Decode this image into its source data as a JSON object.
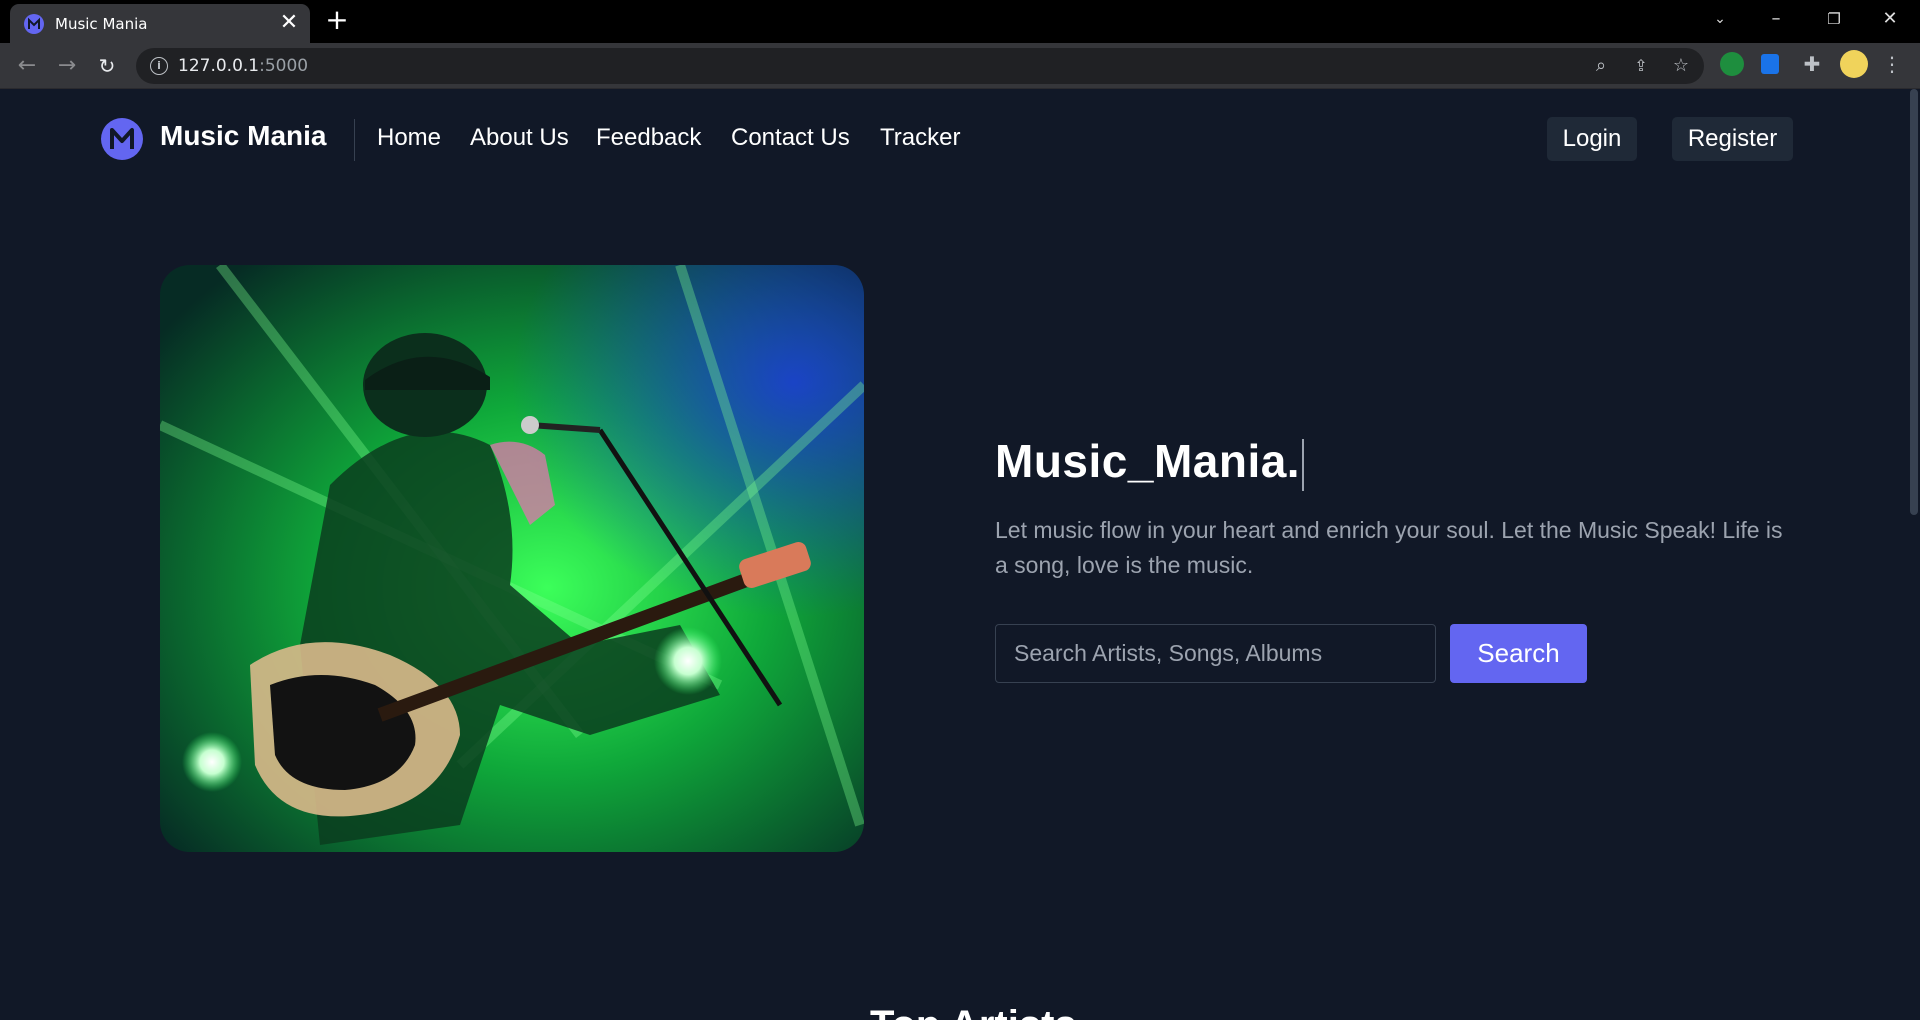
{
  "browser": {
    "tab_title": "Music Mania",
    "tab_close": "✕",
    "new_tab": "+",
    "url_host": "127.0.0.1",
    "url_port": ":5000"
  },
  "nav": {
    "brand": "Music Mania",
    "links": [
      "Home",
      "About Us",
      "Feedback",
      "Contact Us",
      "Tracker"
    ],
    "login": "Login",
    "register": "Register"
  },
  "hero": {
    "title": "Music_Mania.",
    "description": "Let music flow in your heart and enrich your soul. Let the Music Speak! Life is a song, love is the music.",
    "search_placeholder": "Search Artists, Songs, Albums",
    "search_button": "Search"
  },
  "next_section": {
    "heading": "Top Artists"
  },
  "colors": {
    "page_bg": "#111827",
    "accent": "#6366f1",
    "muted_text": "#9ca3af",
    "button_bg": "#1f2937"
  }
}
